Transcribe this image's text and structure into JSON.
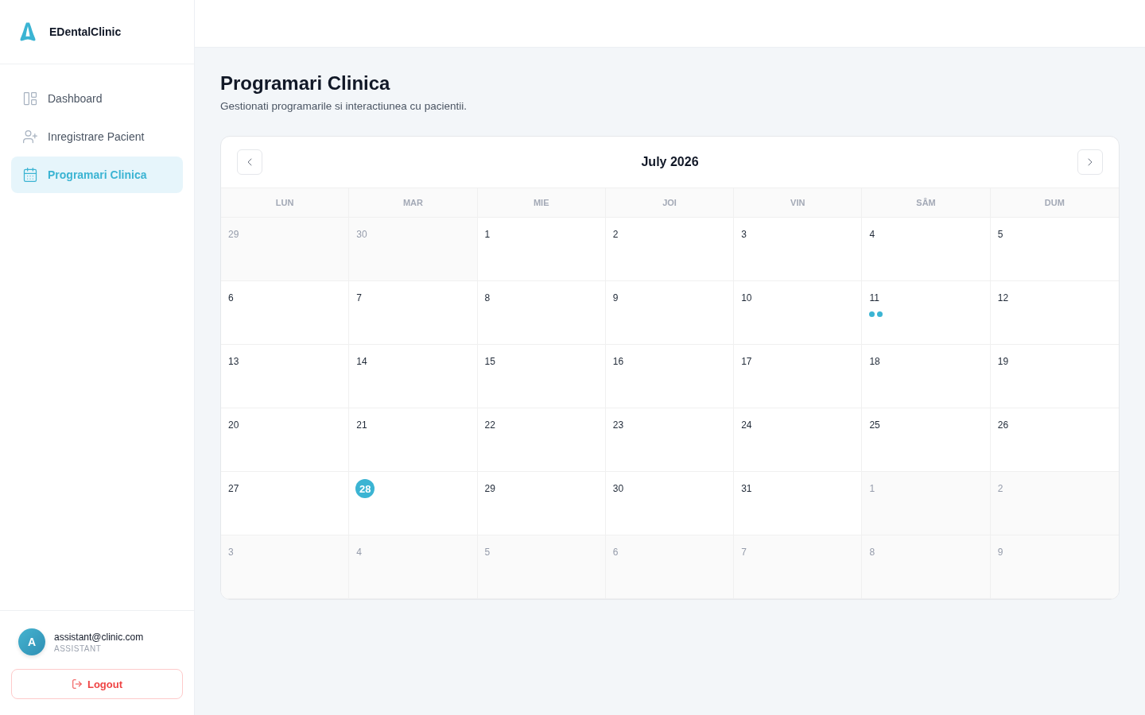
{
  "sidebar": {
    "brand": "EDentalClinic",
    "nav": [
      {
        "label": "Dashboard",
        "selected": false
      },
      {
        "label": "Inregistrare Pacient",
        "selected": false
      },
      {
        "label": "Programari Clinica",
        "selected": true
      }
    ],
    "user": {
      "avatar": "A",
      "email": "assistant@clinic.com",
      "role": "ASSISTANT"
    },
    "logout": "Logout"
  },
  "page": {
    "title": "Programari Clinica",
    "subtitle": "Gestionati programarile si interactiunea cu pacientii."
  },
  "calendar": {
    "month": "July 2026",
    "weekdays": [
      "LUN",
      "MAR",
      "MIE",
      "JOI",
      "VIN",
      "SÂM",
      "DUM"
    ],
    "weeks": [
      [
        {
          "day": "29",
          "outside": true,
          "today": false
        },
        {
          "day": "30",
          "outside": true,
          "today": false
        },
        {
          "day": "1",
          "outside": false,
          "today": false
        },
        {
          "day": "2",
          "outside": false,
          "today": false
        },
        {
          "day": "3",
          "outside": false,
          "today": false
        },
        {
          "day": "4",
          "outside": false,
          "today": false
        },
        {
          "day": "5",
          "outside": false,
          "today": false
        }
      ],
      [
        {
          "day": "6",
          "outside": false,
          "today": false
        },
        {
          "day": "7",
          "outside": false,
          "today": false
        },
        {
          "day": "8",
          "outside": false,
          "today": false
        },
        {
          "day": "9",
          "outside": false,
          "today": false
        },
        {
          "day": "10",
          "outside": false,
          "today": false
        },
        {
          "day": "11",
          "outside": false,
          "today": false,
          "events": [
            {
              "kind": "appointment"
            },
            {
              "kind": "appointment"
            }
          ]
        },
        {
          "day": "12",
          "outside": false,
          "today": false
        }
      ],
      [
        {
          "day": "13",
          "outside": false,
          "today": false
        },
        {
          "day": "14",
          "outside": false,
          "today": false
        },
        {
          "day": "15",
          "outside": false,
          "today": false
        },
        {
          "day": "16",
          "outside": false,
          "today": false
        },
        {
          "day": "17",
          "outside": false,
          "today": false
        },
        {
          "day": "18",
          "outside": false,
          "today": false
        },
        {
          "day": "19",
          "outside": false,
          "today": false
        }
      ],
      [
        {
          "day": "20",
          "outside": false,
          "today": false
        },
        {
          "day": "21",
          "outside": false,
          "today": false
        },
        {
          "day": "22",
          "outside": false,
          "today": false
        },
        {
          "day": "23",
          "outside": false,
          "today": false
        },
        {
          "day": "24",
          "outside": false,
          "today": false
        },
        {
          "day": "25",
          "outside": false,
          "today": false
        },
        {
          "day": "26",
          "outside": false,
          "today": false
        }
      ],
      [
        {
          "day": "27",
          "outside": false,
          "today": false
        },
        {
          "day": "28",
          "outside": false,
          "today": true
        },
        {
          "day": "29",
          "outside": false,
          "today": false
        },
        {
          "day": "30",
          "outside": false,
          "today": false
        },
        {
          "day": "31",
          "outside": false,
          "today": false
        },
        {
          "day": "1",
          "outside": true,
          "today": false
        },
        {
          "day": "2",
          "outside": true,
          "today": false
        }
      ],
      [
        {
          "day": "3",
          "outside": true,
          "today": false
        },
        {
          "day": "4",
          "outside": true,
          "today": false
        },
        {
          "day": "5",
          "outside": true,
          "today": false
        },
        {
          "day": "6",
          "outside": true,
          "today": false
        },
        {
          "day": "7",
          "outside": true,
          "today": false
        },
        {
          "day": "8",
          "outside": true,
          "today": false
        },
        {
          "day": "9",
          "outside": true,
          "today": false
        }
      ]
    ]
  }
}
